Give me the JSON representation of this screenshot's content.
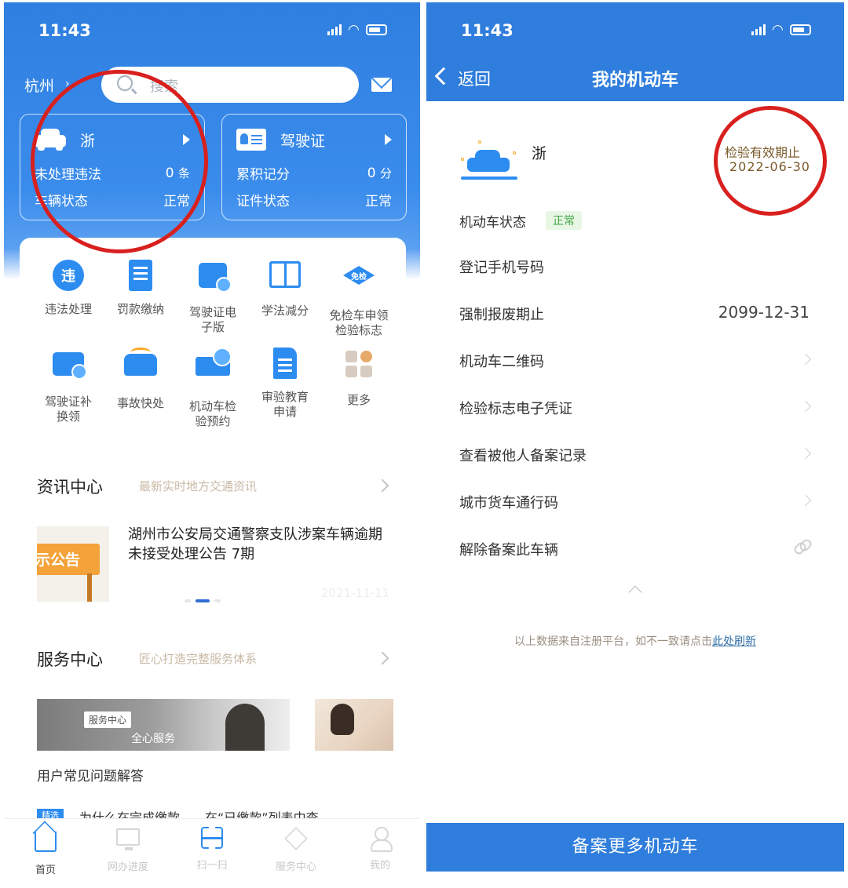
{
  "left": {
    "status": {
      "time": "11:43"
    },
    "header": {
      "city": "杭州",
      "search_placeholder": "搜索"
    },
    "vehicle_card": {
      "title": "浙",
      "violations_label": "未处理违法",
      "violations_count": "0",
      "violations_unit": "条",
      "status_label": "车辆状态",
      "status_value": "正常"
    },
    "license_card": {
      "title": "驾驶证",
      "points_label": "累积记分",
      "points_count": "0",
      "points_unit": "分",
      "status_label": "证件状态",
      "status_value": "正常"
    },
    "services": [
      {
        "label": "违法处理",
        "icon": "violation-icon",
        "glyph": "违"
      },
      {
        "label": "罚款缴纳",
        "icon": "receipt-icon"
      },
      {
        "label": "驾驶证电子版",
        "icon": "license-wallet-icon"
      },
      {
        "label": "学法减分",
        "icon": "book-icon"
      },
      {
        "label": "免检车申领检验标志",
        "icon": "inspection-exempt-icon",
        "glyph": "免检"
      },
      {
        "label": "驾驶证补换领",
        "icon": "license-renew-icon"
      },
      {
        "label": "事故快处",
        "icon": "accident-icon"
      },
      {
        "label": "机动车检验预约",
        "icon": "inspection-booking-icon"
      },
      {
        "label": "审验教育申请",
        "icon": "document-icon"
      },
      {
        "label": "更多",
        "icon": "more-icon"
      }
    ],
    "news": {
      "title": "资讯中心",
      "subtitle": "最新实时地方交通资讯",
      "image_text": "示公告",
      "headline": "湖州市公安局交通警察支队涉案车辆逾期未接受处理公告 7期",
      "date": "2021-11-11"
    },
    "service_center": {
      "title": "服务中心",
      "subtitle": "匠心打造完整服务体系",
      "banner_tag": "服务中心",
      "banner_slogan": "全心服务",
      "faq_title": "用户常见问题解答",
      "faq_tag": "精选",
      "faq_item": "为什么在完成缴款……在“已缴款”列表中查"
    },
    "tabs": [
      {
        "label": "首页",
        "icon": "home-icon",
        "active": true
      },
      {
        "label": "网办进度",
        "icon": "monitor-icon",
        "active": false
      },
      {
        "label": "扫一扫",
        "icon": "scan-icon",
        "active": false
      },
      {
        "label": "服务中心",
        "icon": "service-icon",
        "active": false
      },
      {
        "label": "我的",
        "icon": "user-icon",
        "active": false
      }
    ]
  },
  "right": {
    "status": {
      "time": "11:43"
    },
    "header": {
      "back_label": "返回",
      "title": "我的机动车"
    },
    "vehicle": {
      "plate_prefix": "浙",
      "validity_label": "检验有效期止",
      "validity_date": "2022-06-30"
    },
    "status_row": {
      "label": "机动车状态",
      "badge": "正常"
    },
    "rows": [
      {
        "label": "登记手机号码",
        "value": ""
      },
      {
        "label": "强制报废期止",
        "value": "2099-12-31"
      },
      {
        "label": "机动车二维码"
      },
      {
        "label": "检验标志电子凭证"
      },
      {
        "label": "查看被他人备案记录"
      },
      {
        "label": "城市货车通行码"
      },
      {
        "label": "解除备案此车辆"
      }
    ],
    "footnote_prefix": "以上数据来自注册平台，如不一致请点击",
    "footnote_link": "此处刷新",
    "bottom_button": "备案更多机动车"
  },
  "colors": {
    "brand_blue": "#2f7ddc",
    "annotation_red": "#d8201e",
    "status_green": "#3fa447"
  }
}
